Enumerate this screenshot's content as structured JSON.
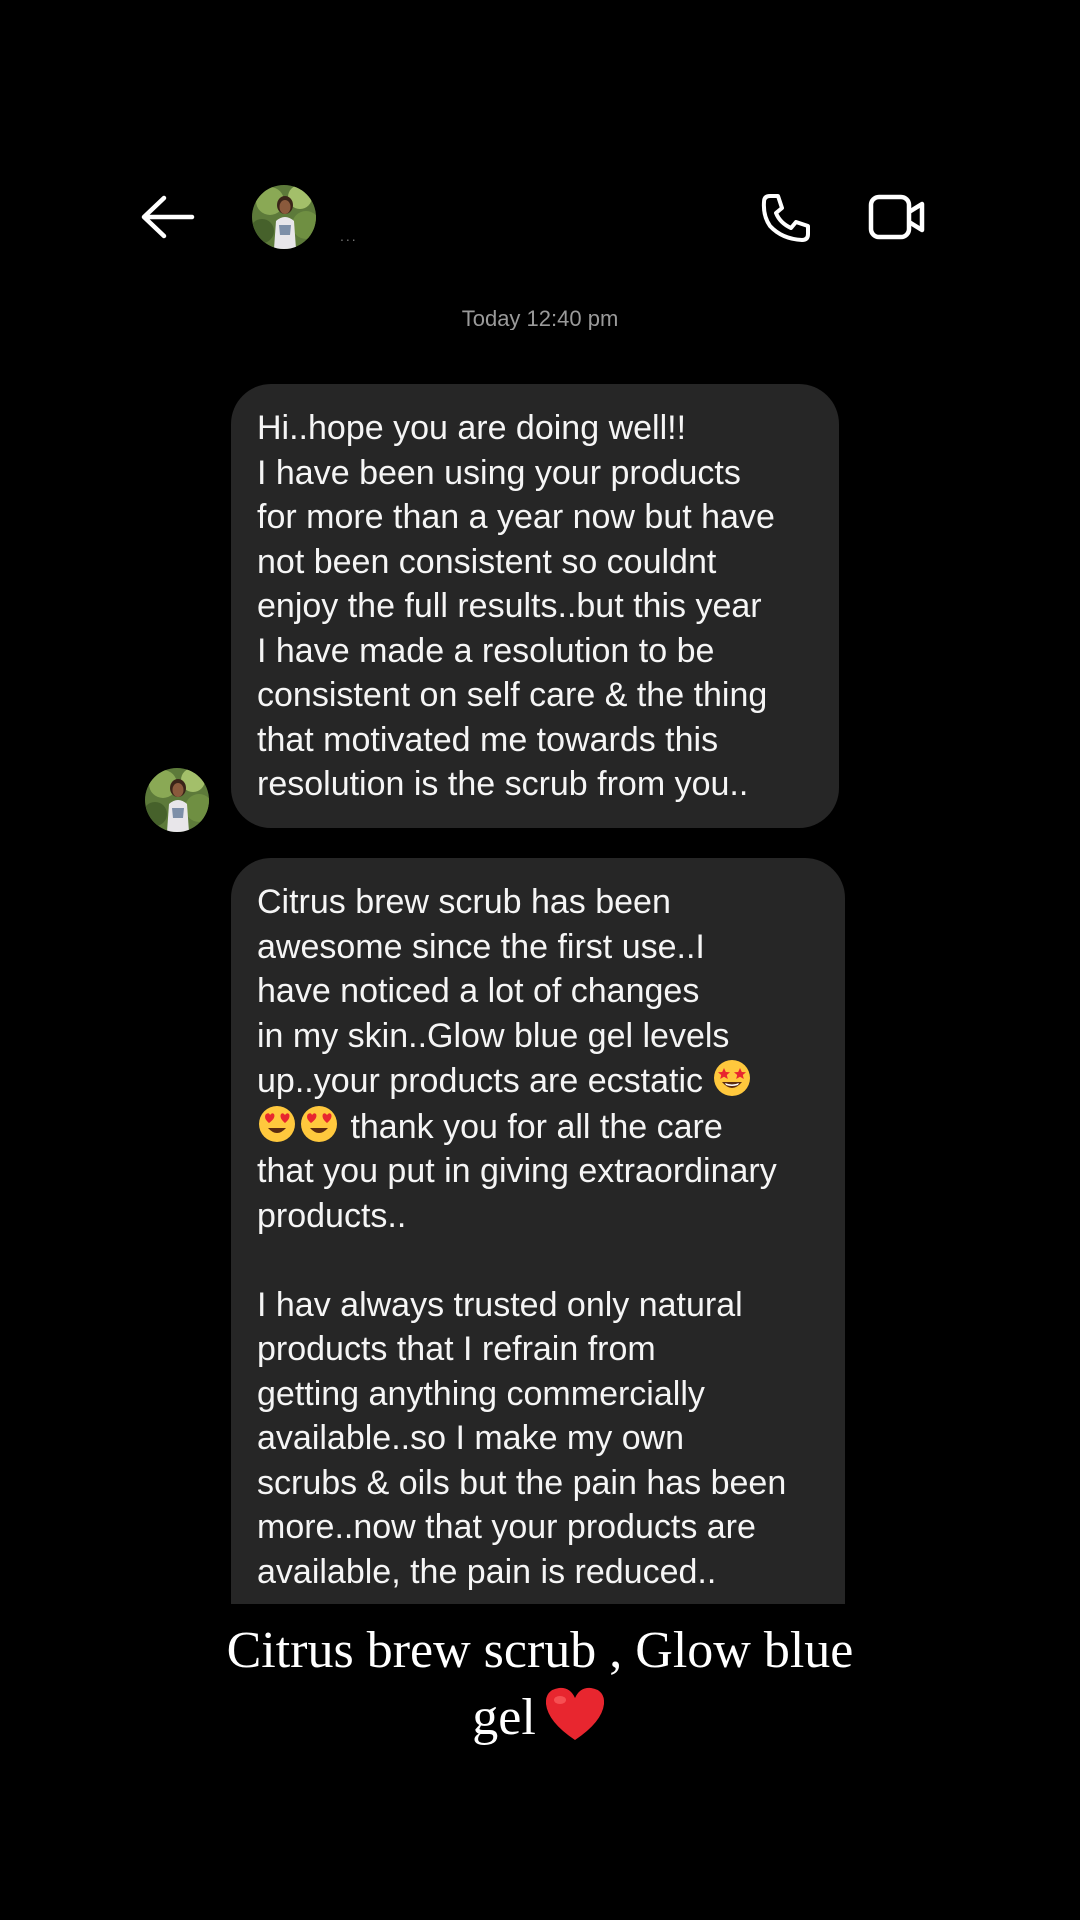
{
  "header": {
    "back_icon": "arrow-left-icon",
    "contact_name": "...",
    "call_icon": "phone-icon",
    "video_icon": "video-camera-icon"
  },
  "timestamp": "Today 12:40 pm",
  "messages": [
    {
      "sender": "contact",
      "text": "Hi..hope you are doing well!!\nI have been using your products\nfor more than a year now but have\nnot been consistent so couldnt\nenjoy the full results..but this year\nI have made a resolution to be\nconsistent on self care & the thing\nthat motivated me towards this\nresolution is the scrub from you.."
    },
    {
      "sender": "contact",
      "part1_a": "Citrus brew scrub has been\nawesome since the first use..I\nhave noticed a lot of changes\nin my skin..Glow blue gel levels\nup..your products are ecstatic ",
      "part1_b": " thank you for all the care\nthat you put in giving extraordinary\nproducts..",
      "part2": "I hav always trusted only natural\nproducts that I refrain from\ngetting anything commercially\navailable..so I make my own\nscrubs & oils but the pain has been\nmore..now that your products are\navailable, the pain is reduced..",
      "emojis": [
        "star-struck-emoji",
        "heart-eyes-emoji",
        "heart-eyes-emoji"
      ]
    }
  ],
  "overlay_caption": {
    "line1": "Citrus brew scrub , Glow blue",
    "line2": "gel",
    "emoji": "red-heart-emoji"
  },
  "colors": {
    "background": "#000000",
    "bubble": "#262626",
    "text": "#f5f5f5",
    "timestamp": "#9a9a9a",
    "heart": "#e8262f"
  }
}
